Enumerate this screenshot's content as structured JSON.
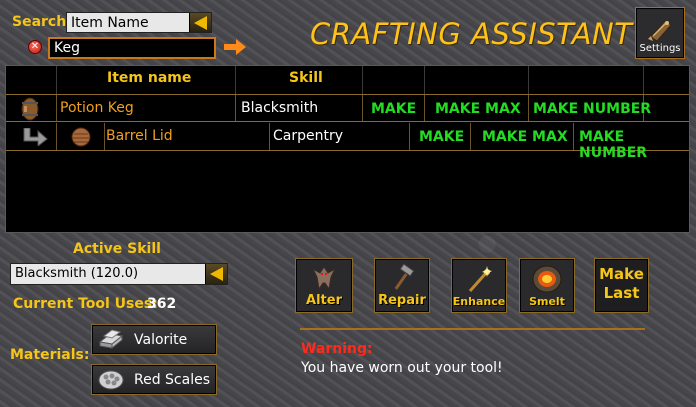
{
  "search": {
    "label": "Search:",
    "mode": "Item Name",
    "query": "Keg"
  },
  "title": "CRAFTING ASSISTANT",
  "settings_label": "Settings",
  "table": {
    "headers": {
      "item": "Item name",
      "skill": "Skill"
    },
    "rows": [
      {
        "item": "Potion Keg",
        "skill": "Blacksmith",
        "make": "MAKE",
        "make_max": "MAKE MAX",
        "make_number": "MAKE NUMBER"
      },
      {
        "item": "Barrel Lid",
        "skill": "Carpentry",
        "make": "MAKE",
        "make_max": "MAKE MAX",
        "make_number": "MAKE NUMBER"
      }
    ]
  },
  "active_skill": {
    "label": "Active Skill",
    "value": "Blacksmith (120.0)"
  },
  "tool_uses": {
    "label": "Current Tool Uses:",
    "value": "362"
  },
  "materials": {
    "label": "Materials:",
    "items": [
      "Valorite",
      "Red Scales"
    ]
  },
  "actions": {
    "alter": "Alter",
    "repair": "Repair",
    "enhance": "Enhance",
    "smelt": "Smelt",
    "make_last_1": "Make",
    "make_last_2": "Last"
  },
  "warning": {
    "title": "Warning:",
    "message": "You have worn out your tool!"
  },
  "colors": {
    "accent": "#f5c518",
    "make_green": "#22dd22",
    "warning_red": "#ff2a1a",
    "border_gold": "#8a6a28"
  }
}
